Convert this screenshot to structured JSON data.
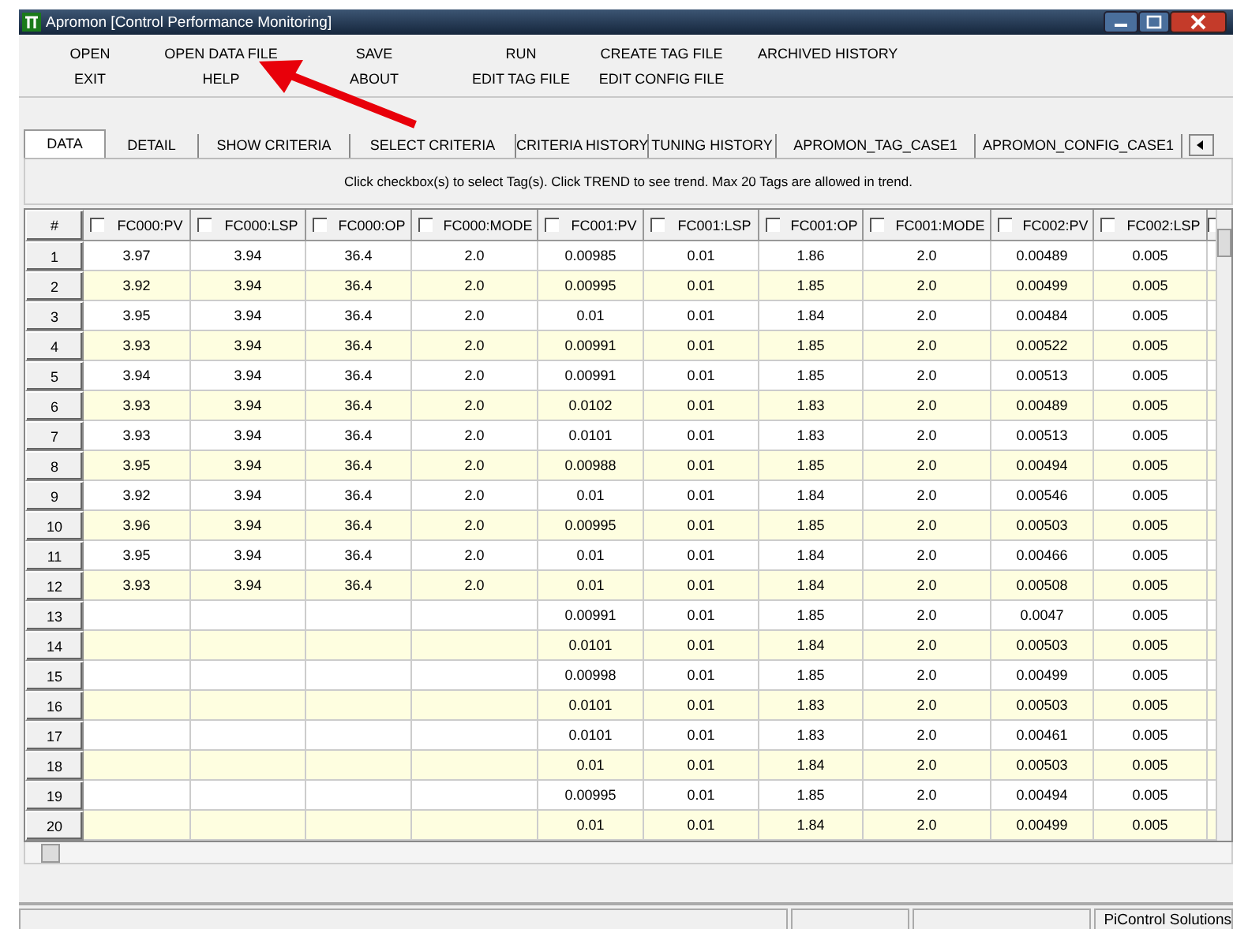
{
  "window": {
    "title": "Apromon [Control Performance Monitoring]"
  },
  "menu": {
    "rows": [
      [
        "OPEN",
        "OPEN DATA FILE",
        "SAVE",
        "RUN",
        "CREATE TAG FILE",
        "ARCHIVED HISTORY"
      ],
      [
        "EXIT",
        "HELP",
        "ABOUT",
        "EDIT TAG FILE",
        "EDIT CONFIG FILE"
      ]
    ]
  },
  "tabs": [
    {
      "label": "DATA",
      "selected": true
    },
    {
      "label": "DETAIL",
      "selected": false
    },
    {
      "label": "SHOW CRITERIA",
      "selected": false
    },
    {
      "label": "SELECT CRITERIA",
      "selected": false
    },
    {
      "label": "CRITERIA HISTORY",
      "selected": false
    },
    {
      "label": "TUNING HISTORY",
      "selected": false
    },
    {
      "label": "APROMON_TAG_CASE1",
      "selected": false
    },
    {
      "label": "APROMON_CONFIG_CASE1",
      "selected": false
    }
  ],
  "hint": "Click checkbox(s) to select Tag(s). Click TREND to see trend. Max 20 Tags are allowed in trend.",
  "table": {
    "index_header": "#",
    "columns": [
      {
        "label": "FC000:PV",
        "checked": false
      },
      {
        "label": "FC000:LSP",
        "checked": false
      },
      {
        "label": "FC000:OP",
        "checked": false
      },
      {
        "label": "FC000:MODE",
        "checked": false
      },
      {
        "label": "FC001:PV",
        "checked": false
      },
      {
        "label": "FC001:LSP",
        "checked": false
      },
      {
        "label": "FC001:OP",
        "checked": false
      },
      {
        "label": "FC001:MODE",
        "checked": false
      },
      {
        "label": "FC002:PV",
        "checked": false
      },
      {
        "label": "FC002:LSP",
        "checked": false
      },
      {
        "checked": false
      }
    ],
    "rows": [
      {
        "num": "1",
        "cells": [
          "3.97",
          "3.94",
          "36.4",
          "2.0",
          "0.00985",
          "0.01",
          "1.86",
          "2.0",
          "0.00489",
          "0.005"
        ]
      },
      {
        "num": "2",
        "cells": [
          "3.92",
          "3.94",
          "36.4",
          "2.0",
          "0.00995",
          "0.01",
          "1.85",
          "2.0",
          "0.00499",
          "0.005"
        ]
      },
      {
        "num": "3",
        "cells": [
          "3.95",
          "3.94",
          "36.4",
          "2.0",
          "0.01",
          "0.01",
          "1.84",
          "2.0",
          "0.00484",
          "0.005"
        ]
      },
      {
        "num": "4",
        "cells": [
          "3.93",
          "3.94",
          "36.4",
          "2.0",
          "0.00991",
          "0.01",
          "1.85",
          "2.0",
          "0.00522",
          "0.005"
        ]
      },
      {
        "num": "5",
        "cells": [
          "3.94",
          "3.94",
          "36.4",
          "2.0",
          "0.00991",
          "0.01",
          "1.85",
          "2.0",
          "0.00513",
          "0.005"
        ]
      },
      {
        "num": "6",
        "cells": [
          "3.93",
          "3.94",
          "36.4",
          "2.0",
          "0.0102",
          "0.01",
          "1.83",
          "2.0",
          "0.00489",
          "0.005"
        ]
      },
      {
        "num": "7",
        "cells": [
          "3.93",
          "3.94",
          "36.4",
          "2.0",
          "0.0101",
          "0.01",
          "1.83",
          "2.0",
          "0.00513",
          "0.005"
        ]
      },
      {
        "num": "8",
        "cells": [
          "3.95",
          "3.94",
          "36.4",
          "2.0",
          "0.00988",
          "0.01",
          "1.85",
          "2.0",
          "0.00494",
          "0.005"
        ]
      },
      {
        "num": "9",
        "cells": [
          "3.92",
          "3.94",
          "36.4",
          "2.0",
          "0.01",
          "0.01",
          "1.84",
          "2.0",
          "0.00546",
          "0.005"
        ]
      },
      {
        "num": "10",
        "cells": [
          "3.96",
          "3.94",
          "36.4",
          "2.0",
          "0.00995",
          "0.01",
          "1.85",
          "2.0",
          "0.00503",
          "0.005"
        ]
      },
      {
        "num": "11",
        "cells": [
          "3.95",
          "3.94",
          "36.4",
          "2.0",
          "0.01",
          "0.01",
          "1.84",
          "2.0",
          "0.00466",
          "0.005"
        ]
      },
      {
        "num": "12",
        "cells": [
          "3.93",
          "3.94",
          "36.4",
          "2.0",
          "0.01",
          "0.01",
          "1.84",
          "2.0",
          "0.00508",
          "0.005"
        ]
      },
      {
        "num": "13",
        "cells": [
          null,
          null,
          null,
          null,
          "0.00991",
          "0.01",
          "1.85",
          "2.0",
          "0.0047",
          "0.005"
        ]
      },
      {
        "num": "14",
        "cells": [
          null,
          null,
          null,
          null,
          "0.0101",
          "0.01",
          "1.84",
          "2.0",
          "0.00503",
          "0.005"
        ]
      },
      {
        "num": "15",
        "cells": [
          null,
          null,
          null,
          null,
          "0.00998",
          "0.01",
          "1.85",
          "2.0",
          "0.00499",
          "0.005"
        ]
      },
      {
        "num": "16",
        "cells": [
          null,
          null,
          null,
          null,
          "0.0101",
          "0.01",
          "1.83",
          "2.0",
          "0.00503",
          "0.005"
        ]
      },
      {
        "num": "17",
        "cells": [
          null,
          null,
          null,
          null,
          "0.0101",
          "0.01",
          "1.83",
          "2.0",
          "0.00461",
          "0.005"
        ]
      },
      {
        "num": "18",
        "cells": [
          null,
          null,
          null,
          null,
          "0.01",
          "0.01",
          "1.84",
          "2.0",
          "0.00503",
          "0.005"
        ]
      },
      {
        "num": "19",
        "cells": [
          null,
          null,
          null,
          null,
          "0.00995",
          "0.01",
          "1.85",
          "2.0",
          "0.00494",
          "0.005"
        ]
      },
      {
        "num": "20",
        "cells": [
          null,
          null,
          null,
          null,
          "0.01",
          "0.01",
          "1.84",
          "2.0",
          "0.00499",
          "0.005"
        ]
      }
    ]
  },
  "status_bar": {
    "right_text": "PiControl Solutions"
  }
}
